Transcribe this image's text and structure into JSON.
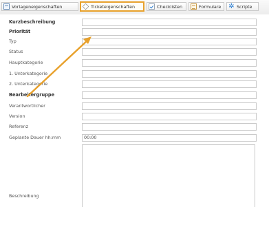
{
  "tabs": [
    {
      "label": "Vorlageneigenschaften",
      "icon": "window-icon"
    },
    {
      "label": "Ticketeigenschaften",
      "icon": "tag-icon",
      "active": true
    },
    {
      "label": "Checklisten",
      "icon": "checklist-icon"
    },
    {
      "label": "Formulare",
      "icon": "form-icon"
    },
    {
      "label": "Scripte",
      "icon": "gear-icon"
    }
  ],
  "fields": {
    "kurzbeschreibung": {
      "label": "Kurzbeschreibung",
      "value": ""
    },
    "prioritaet": {
      "label": "Priorität",
      "value": ""
    },
    "typ": {
      "label": "Typ",
      "value": ""
    },
    "status": {
      "label": "Status",
      "value": ""
    },
    "hauptkategorie": {
      "label": "Hauptkategorie",
      "value": ""
    },
    "unterkategorie1": {
      "label": "1. Unterkategorie",
      "value": ""
    },
    "unterkategorie2": {
      "label": "2. Unterkategorie",
      "value": ""
    },
    "bearbeitergruppe": {
      "label": "Bearbeitergruppe",
      "value": ""
    },
    "verantwortlicher": {
      "label": "Verantwortlicher",
      "value": ""
    },
    "version": {
      "label": "Version",
      "value": ""
    },
    "referenz": {
      "label": "Referenz",
      "value": ""
    },
    "geplante_dauer": {
      "label": "Geplante Dauer hh:mm",
      "value": "00:00"
    },
    "beschreibung": {
      "label": "Beschreibung",
      "value": ""
    }
  },
  "colors": {
    "highlight": "#e8a12c",
    "border": "#c9c9c9"
  }
}
